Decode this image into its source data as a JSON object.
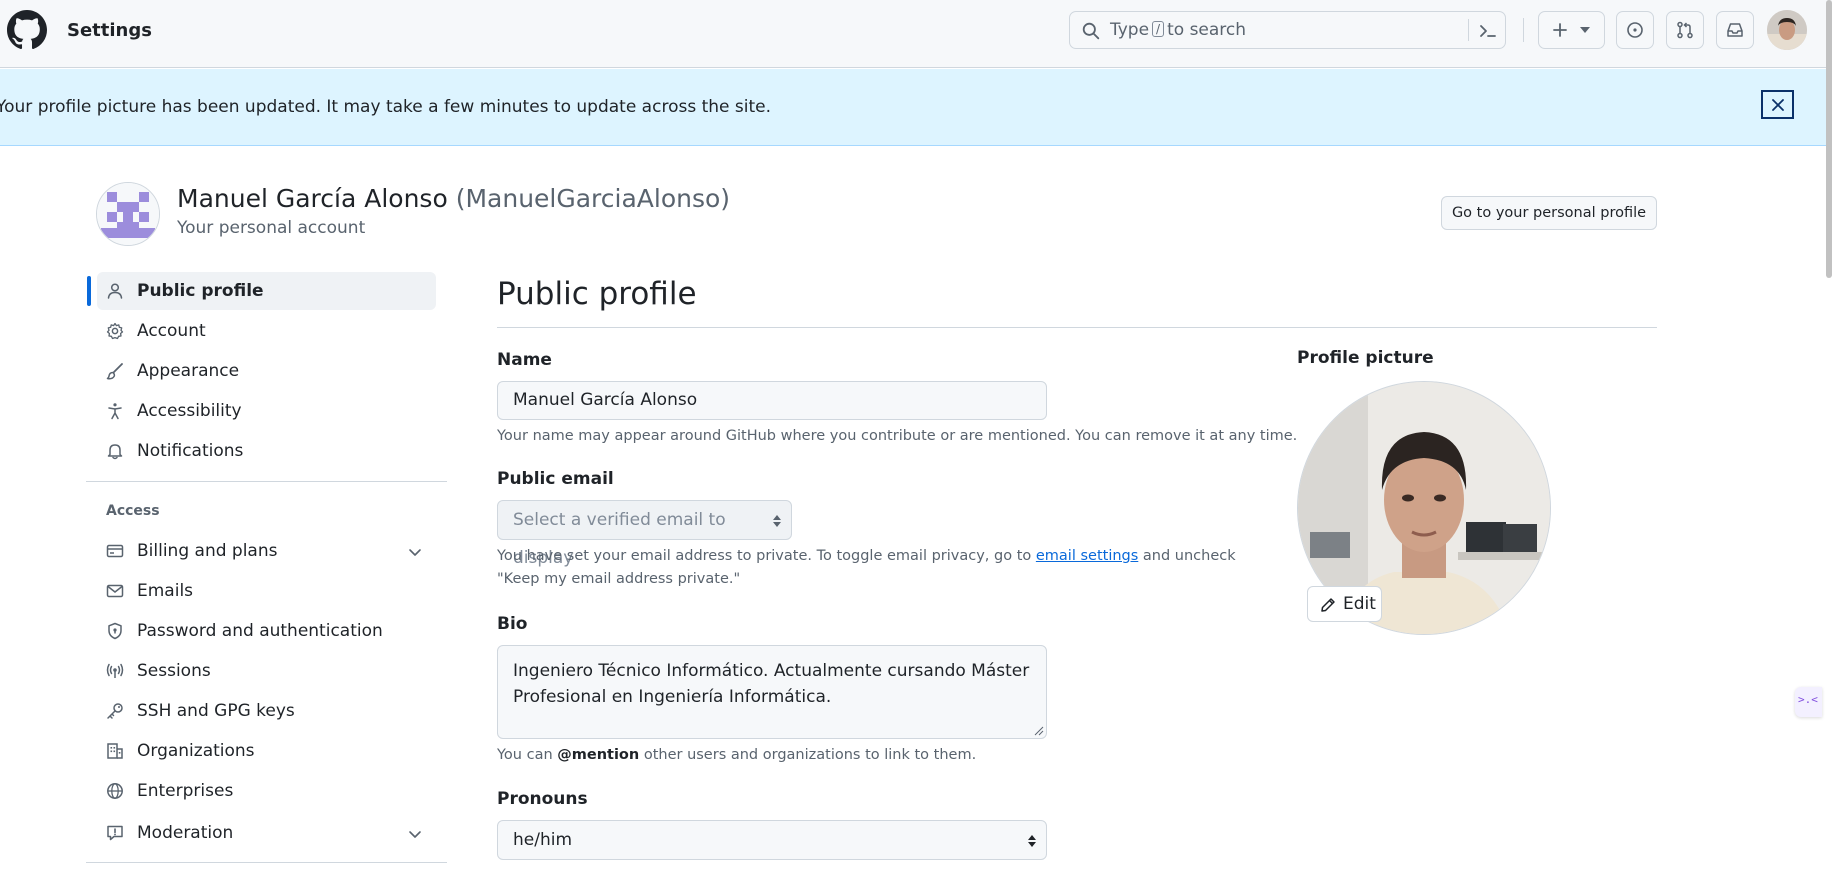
{
  "header": {
    "title": "Settings",
    "search_prefix": "Type",
    "search_key": "/",
    "search_suffix": "to search"
  },
  "flash": {
    "message": "Your profile picture has been updated. It may take a few minutes to update across the site."
  },
  "account": {
    "name": "Manuel García Alonso",
    "login": "(ManuelGarciaAlonso)",
    "subtitle": "Your personal account",
    "go_profile_label": "Go to your personal profile"
  },
  "sidebar": {
    "items": [
      {
        "label": "Public profile",
        "icon": "person-icon",
        "active": true
      },
      {
        "label": "Account",
        "icon": "gear-icon"
      },
      {
        "label": "Appearance",
        "icon": "paintbrush-icon"
      },
      {
        "label": "Accessibility",
        "icon": "accessibility-icon"
      },
      {
        "label": "Notifications",
        "icon": "bell-icon"
      }
    ],
    "access_title": "Access",
    "access_items": [
      {
        "label": "Billing and plans",
        "icon": "credit-card-icon",
        "expandable": true
      },
      {
        "label": "Emails",
        "icon": "mail-icon"
      },
      {
        "label": "Password and authentication",
        "icon": "shield-lock-icon"
      },
      {
        "label": "Sessions",
        "icon": "broadcast-icon"
      },
      {
        "label": "SSH and GPG keys",
        "icon": "key-icon"
      },
      {
        "label": "Organizations",
        "icon": "organization-icon"
      },
      {
        "label": "Enterprises",
        "icon": "globe-icon"
      },
      {
        "label": "Moderation",
        "icon": "report-icon",
        "expandable": true
      }
    ]
  },
  "main": {
    "title": "Public profile",
    "name_label": "Name",
    "name_value": "Manuel García Alonso",
    "name_hint": "Your name may appear around GitHub where you contribute or are mentioned. You can remove it at any time.",
    "email_label": "Public email",
    "email_placeholder": "Select a verified email to display",
    "email_hint_pre": "You have set your email address to private. To toggle email privacy, go to",
    "email_hint_link": "email settings",
    "email_hint_post": "and uncheck \"Keep my email address private.\"",
    "bio_label": "Bio",
    "bio_value": "Ingeniero Técnico Informático. Actualmente cursando Máster Profesional en Ingeniería Informática.",
    "bio_hint_pre": "You can",
    "bio_hint_mention": "@mention",
    "bio_hint_post": "other users and organizations to link to them.",
    "pronouns_label": "Pronouns",
    "pronouns_value": "he/him"
  },
  "profile_picture": {
    "label": "Profile picture",
    "edit_label": "Edit"
  },
  "colors": {
    "accent": "#0969da",
    "flash_bg": "#ddf4ff",
    "header_bg": "#f6f8fa"
  }
}
